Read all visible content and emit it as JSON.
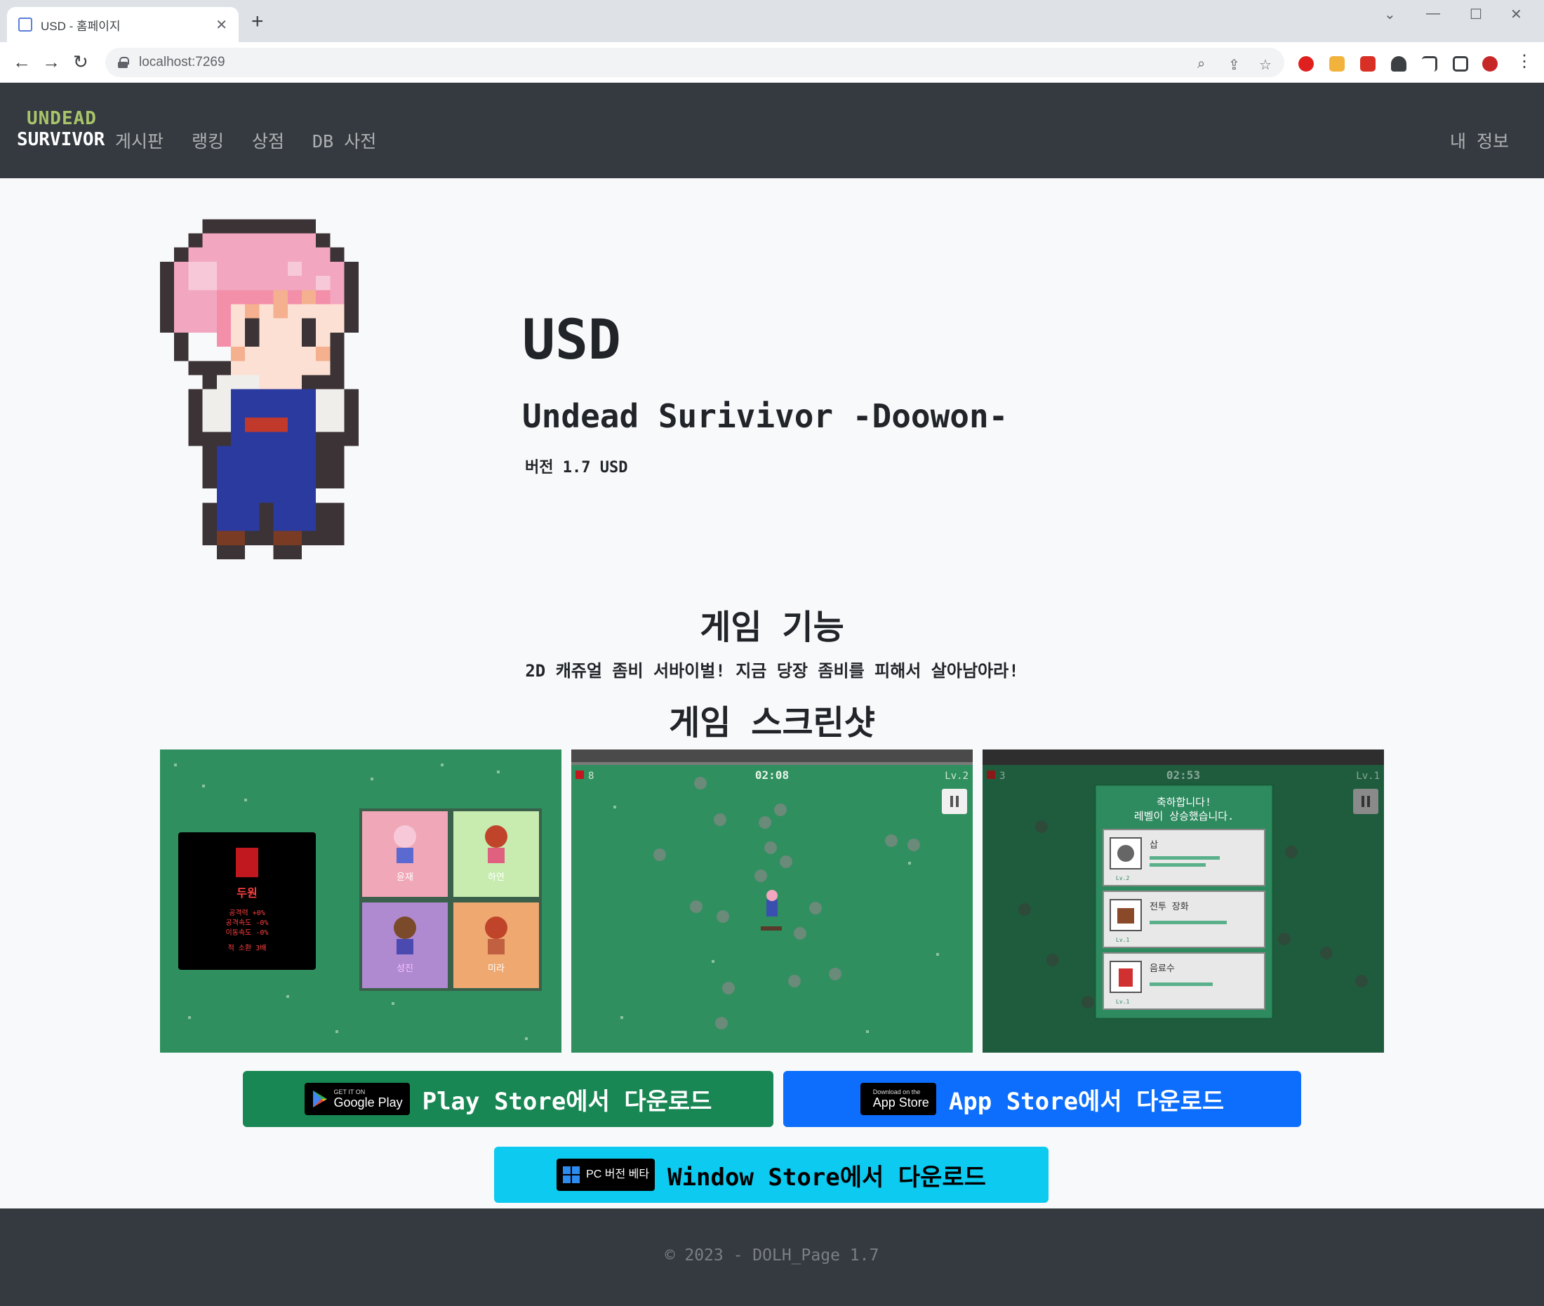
{
  "browser": {
    "tab_title": "USD - 홈페이지",
    "url": "localhost:7269"
  },
  "nav": {
    "logo_top": "UNDEAD",
    "logo_bottom": "SURVIVOR",
    "links": [
      "게시판",
      "랭킹",
      "상점",
      "DB 사전"
    ],
    "my_info": "내 정보"
  },
  "hero": {
    "title": "USD",
    "subtitle": "Undead Surivivor -Doowon-",
    "version": "버전 1.7 USD"
  },
  "features": {
    "title": "게임 기능",
    "description": "2D 캐쥬얼 좀비 서바이벌! 지금 당장 좀비를 피해서 살아남아라!"
  },
  "screenshots": {
    "title": "게임 스크린샷",
    "shot1": {
      "selected_name": "두원",
      "selected_stats": [
        "공격력 +0%",
        "공격속도 -0%",
        "이동속도 -0%"
      ],
      "selected_extra": "적 소환 3배",
      "cards": [
        "윤재",
        "하연",
        "성진",
        "미라"
      ]
    },
    "shot2": {
      "timer": "02:08",
      "kills": "8",
      "level": "Lv.2"
    },
    "shot3": {
      "timer": "02:53",
      "kills": "3",
      "level": "Lv.1",
      "popup_title_1": "축하합니다!",
      "popup_title_2": "레벨이 상승했습니다.",
      "items": [
        {
          "name": "삽",
          "level": "Lv.2"
        },
        {
          "name": "전투 장화",
          "level": "Lv.1"
        },
        {
          "name": "음료수",
          "level": "Lv.1"
        }
      ]
    }
  },
  "downloads": {
    "play": {
      "label": "Play Store에서 다운로드",
      "badge_small": "GET IT ON",
      "badge_big": "Google Play",
      "color": "#198754"
    },
    "app": {
      "label": "App Store에서 다운로드",
      "badge_small": "Download on the",
      "badge_big": "App Store",
      "color": "#0d6efd"
    },
    "window": {
      "label": "Window Store에서 다운로드",
      "badge_big": "PC 버전 베타",
      "color": "#0dcaf0"
    }
  },
  "footer": {
    "text": "© 2023 - DOLH_Page 1.7"
  }
}
